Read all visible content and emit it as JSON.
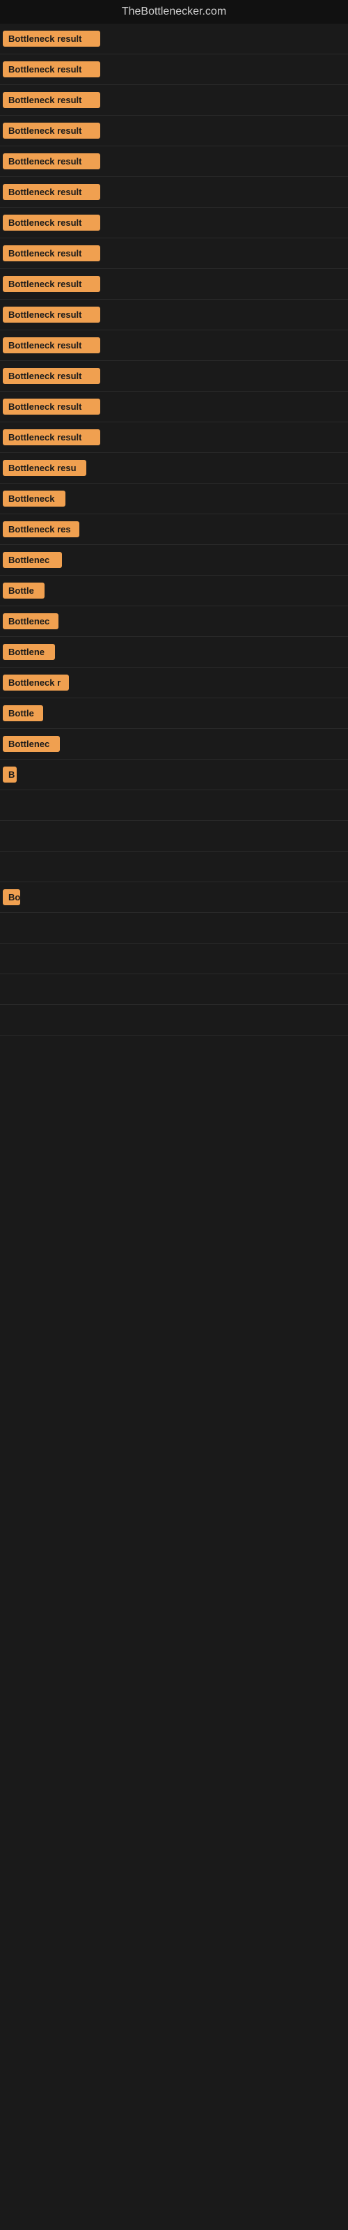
{
  "site": {
    "title": "TheBottlenecker.com"
  },
  "rows": [
    {
      "badge": "Bottleneck result",
      "width": 140
    },
    {
      "badge": "Bottleneck result",
      "width": 140
    },
    {
      "badge": "Bottleneck result",
      "width": 140
    },
    {
      "badge": "Bottleneck result",
      "width": 140
    },
    {
      "badge": "Bottleneck result",
      "width": 140
    },
    {
      "badge": "Bottleneck result",
      "width": 140
    },
    {
      "badge": "Bottleneck result",
      "width": 140
    },
    {
      "badge": "Bottleneck result",
      "width": 140
    },
    {
      "badge": "Bottleneck result",
      "width": 140
    },
    {
      "badge": "Bottleneck result",
      "width": 140
    },
    {
      "badge": "Bottleneck result",
      "width": 140
    },
    {
      "badge": "Bottleneck result",
      "width": 140
    },
    {
      "badge": "Bottleneck result",
      "width": 140
    },
    {
      "badge": "Bottleneck result",
      "width": 140
    },
    {
      "badge": "Bottleneck resu",
      "width": 120
    },
    {
      "badge": "Bottleneck",
      "width": 90
    },
    {
      "badge": "Bottleneck res",
      "width": 110
    },
    {
      "badge": "Bottlenec",
      "width": 85
    },
    {
      "badge": "Bottle",
      "width": 60
    },
    {
      "badge": "Bottlenec",
      "width": 80
    },
    {
      "badge": "Bottlene",
      "width": 75
    },
    {
      "badge": "Bottleneck r",
      "width": 95
    },
    {
      "badge": "Bottle",
      "width": 58
    },
    {
      "badge": "Bottlenec",
      "width": 82
    },
    {
      "badge": "B",
      "width": 20
    },
    {
      "badge": "",
      "width": 0
    },
    {
      "badge": "",
      "width": 0
    },
    {
      "badge": "",
      "width": 0
    },
    {
      "badge": "Bo",
      "width": 25
    },
    {
      "badge": "",
      "width": 0
    },
    {
      "badge": "",
      "width": 0
    },
    {
      "badge": "",
      "width": 0
    },
    {
      "badge": "",
      "width": 0
    }
  ]
}
